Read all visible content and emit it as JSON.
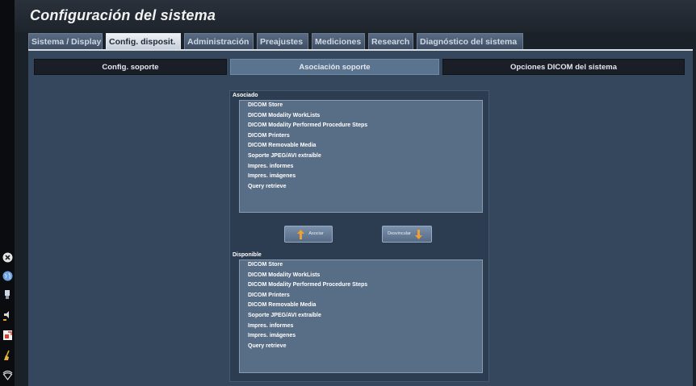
{
  "window": {
    "title": "Configuración del sistema"
  },
  "tabs": [
    {
      "label": "Sistema / Display"
    },
    {
      "label": "Config. disposit."
    },
    {
      "label": "Administración"
    },
    {
      "label": "Preajustes"
    },
    {
      "label": "Mediciones"
    },
    {
      "label": "Research"
    },
    {
      "label": "Diagnóstico del sistema"
    }
  ],
  "active_tab": "Config. disposit.",
  "subtabs": [
    {
      "label": "Config. soporte"
    },
    {
      "label": "Asociación soporte"
    },
    {
      "label": "Opciones DICOM del sistema"
    }
  ],
  "active_subtab": "Asociación soporte",
  "associated": {
    "label": "Asociado",
    "items": [
      "DICOM Store",
      "DICOM Modality WorkLists",
      "DICOM Modality Performed Procedure Steps",
      "DICOM Printers",
      "DICOM Removable Media",
      "Soporte JPEG/AVI extraíble",
      "Impres. informes",
      "Impres. imágenes",
      "Query retrieve"
    ]
  },
  "available": {
    "label": "Disponible",
    "items": [
      "DICOM Store",
      "DICOM Modality WorkLists",
      "DICOM Modality Performed Procedure Steps",
      "DICOM Printers",
      "DICOM Removable Media",
      "Soporte JPEG/AVI extraíble",
      "Impres. informes",
      "Impres. imágenes",
      "Query retrieve"
    ]
  },
  "buttons": {
    "associate": "Asociar",
    "disassociate": "Desvincular"
  },
  "left_icons": [
    "close-icon",
    "globe-icon",
    "probe-icon",
    "volume-icon",
    "export-icon",
    "clean-icon",
    "wifi-icon"
  ],
  "colors": {
    "accent_orange": "#f0a030",
    "panel_blue": "#586d86",
    "active_subtab": "#5a7490"
  }
}
